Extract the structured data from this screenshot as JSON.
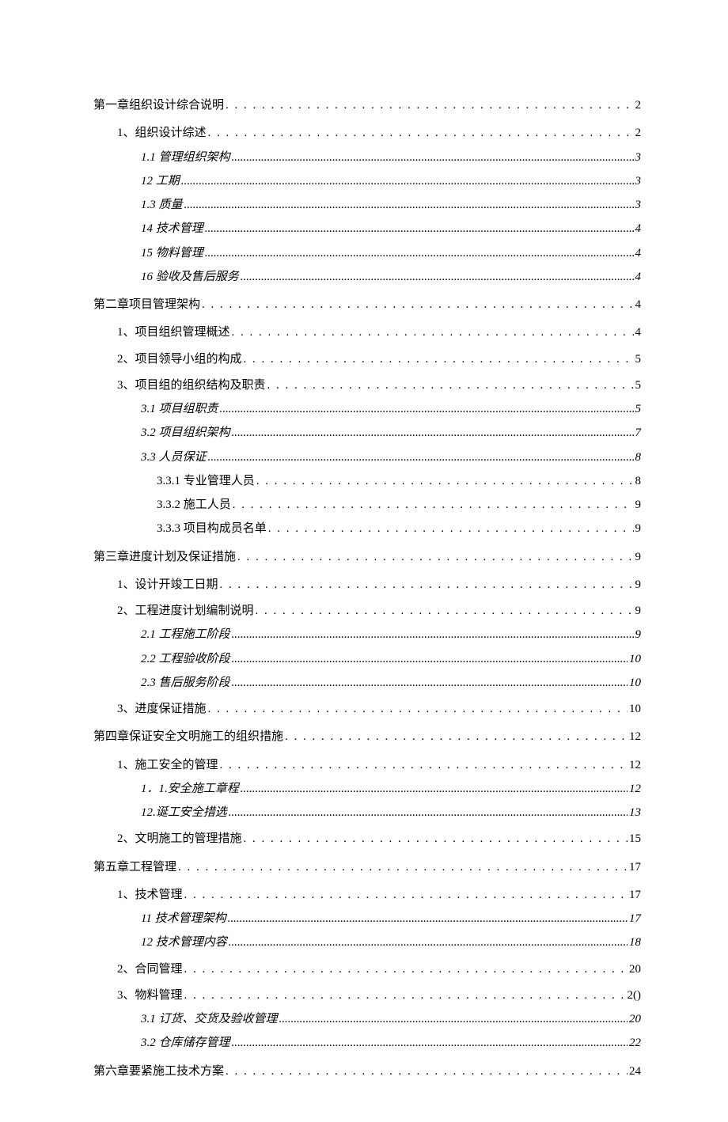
{
  "toc": [
    {
      "level": 0,
      "label": "第一章组织设计综合说明",
      "page": "2",
      "dots": "coarse"
    },
    {
      "level": 1,
      "label": "1、组织设计综述",
      "page": "2",
      "dots": "coarse"
    },
    {
      "level": 2,
      "label": "1.1 管理组织架构",
      "page": "3",
      "dots": "fine"
    },
    {
      "level": 2,
      "label": "12 工期",
      "page": "3",
      "dots": "fine"
    },
    {
      "level": 2,
      "label": "1.3 质量",
      "page": "3",
      "dots": "fine"
    },
    {
      "level": 2,
      "label": "14 技术管理",
      "page": "4",
      "dots": "fine"
    },
    {
      "level": 2,
      "label": "15 物料管理",
      "page": "4",
      "dots": "fine"
    },
    {
      "level": 2,
      "label": "16 验收及售后服务",
      "page": "4",
      "dots": "fine"
    },
    {
      "level": 0,
      "label": "第二章项目管理架构",
      "page": "4",
      "dots": "coarse"
    },
    {
      "level": 1,
      "label": "1、项目组织管理概述",
      "page": "4",
      "dots": "coarse"
    },
    {
      "level": 1,
      "label": "2、项目领导小组的构成",
      "page": "5",
      "dots": "coarse"
    },
    {
      "level": 1,
      "label": "3、项目组的组织结构及职责",
      "page": "5",
      "dots": "coarse"
    },
    {
      "level": 2,
      "label": "3.1 项目组职责",
      "page": "5",
      "dots": "fine"
    },
    {
      "level": 2,
      "label": "3.2 项目组织架构",
      "page": "7",
      "dots": "fine"
    },
    {
      "level": 2,
      "label": "3.3 人员保证",
      "page": "8",
      "dots": "fine"
    },
    {
      "level": 3,
      "label": "3.3.1 专业管理人员",
      "page": "8",
      "dots": "coarse"
    },
    {
      "level": 3,
      "label": "3.3.2 施工人员",
      "page": "9",
      "dots": "coarse"
    },
    {
      "level": 3,
      "label": "3.3.3 项目构成员名单",
      "page": "9",
      "dots": "coarse"
    },
    {
      "level": 0,
      "label": "第三章进度计划及保证措施",
      "page": "9",
      "dots": "coarse"
    },
    {
      "level": 1,
      "label": "1、设计开竣工日期",
      "page": "9",
      "dots": "coarse"
    },
    {
      "level": 1,
      "label": "2、工程进度计划编制说明",
      "page": "9",
      "dots": "coarse"
    },
    {
      "level": 2,
      "label": "2.1 工程施工阶段",
      "page": "9",
      "dots": "fine"
    },
    {
      "level": 2,
      "label": "2.2 工程验收阶段",
      "page": "10",
      "dots": "fine"
    },
    {
      "level": 2,
      "label": "2.3 售后服务阶段",
      "page": "10",
      "dots": "fine"
    },
    {
      "level": 1,
      "label": "3、进度保证措施",
      "page": "10",
      "dots": "coarse"
    },
    {
      "level": 0,
      "label": "第四章保证安全文明施工的组织措施",
      "page": "12",
      "dots": "coarse"
    },
    {
      "level": 1,
      "label": "1、施工安全的管理",
      "page": "12",
      "dots": "coarse"
    },
    {
      "level": 2,
      "label": "1．1.安全施工章程",
      "page": "12",
      "dots": "fine"
    },
    {
      "level": 2,
      "label": "12.诞工安全措选",
      "page": "13",
      "dots": "fine"
    },
    {
      "level": 1,
      "label": "2、文明施工的管理措施",
      "page": "15",
      "dots": "coarse"
    },
    {
      "level": 0,
      "label": "第五章工程管理",
      "page": "17",
      "dots": "coarse"
    },
    {
      "level": 1,
      "label": "1、技术管理",
      "page": "17",
      "dots": "coarse"
    },
    {
      "level": 2,
      "label": "11 技术管理架构",
      "page": "17",
      "dots": "fine"
    },
    {
      "level": 2,
      "label": "12 技术管理内容",
      "page": "18",
      "dots": "fine"
    },
    {
      "level": 1,
      "label": "2、合同管理",
      "page": "20",
      "dots": "coarse"
    },
    {
      "level": 1,
      "label": "3、物料管理",
      "page": "2()",
      "dots": "coarse"
    },
    {
      "level": 2,
      "label": "3.1 订货、交货及验收管理",
      "page": "20",
      "dots": "fine"
    },
    {
      "level": 2,
      "label": "3.2 仓库储存管理",
      "page": "22",
      "dots": "fine"
    },
    {
      "level": 0,
      "label": "第六章要紧施工技术方案",
      "page": "24",
      "dots": "coarse"
    }
  ]
}
